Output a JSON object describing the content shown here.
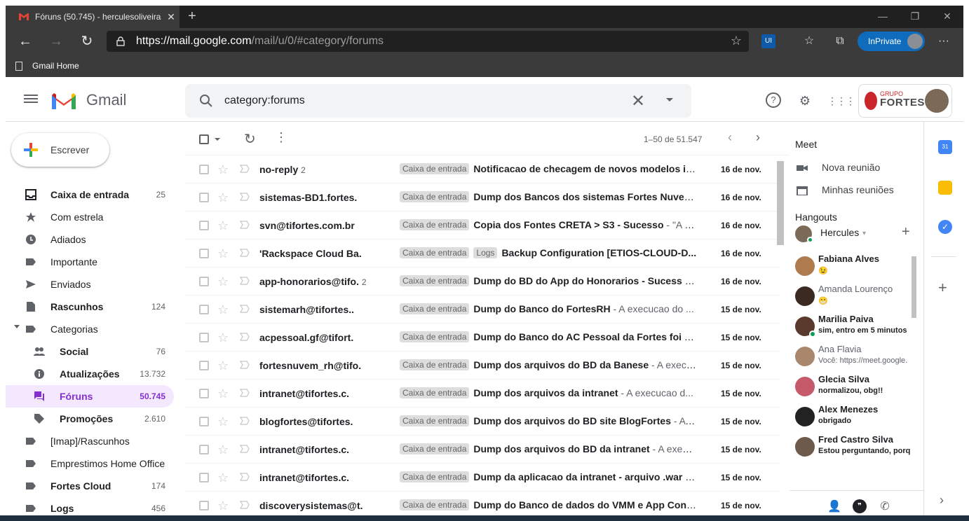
{
  "browser": {
    "tab_title": "Fóruns (50.745) - herculesoliveira",
    "url_host": "https://mail.google.com",
    "url_path": "/mail/u/0/#category/forums",
    "fav_label": "Gmail Home",
    "inprivate": "InPrivate"
  },
  "gmail": {
    "app_name": "Gmail",
    "search_value": "category:forums",
    "compose": "Escrever",
    "brand_small": "GRUPO",
    "brand": "FORTES"
  },
  "nav": [
    {
      "label": "Caixa de entrada",
      "count": "25",
      "bold": true
    },
    {
      "label": "Com estrela",
      "count": ""
    },
    {
      "label": "Adiados",
      "count": ""
    },
    {
      "label": "Importante",
      "count": ""
    },
    {
      "label": "Enviados",
      "count": ""
    },
    {
      "label": "Rascunhos",
      "count": "124",
      "bold": true
    },
    {
      "label": "Categorias",
      "count": ""
    },
    {
      "label": "Social",
      "count": "76",
      "bold": true
    },
    {
      "label": "Atualizações",
      "count": "13.732",
      "bold": true
    },
    {
      "label": "Fóruns",
      "count": "50.745",
      "bold": true
    },
    {
      "label": "Promoções",
      "count": "2.610",
      "bold": true
    },
    {
      "label": "[Imap]/Rascunhos",
      "count": ""
    },
    {
      "label": "Emprestimos Home Office",
      "count": ""
    },
    {
      "label": "Fortes Cloud",
      "count": "174",
      "bold": true
    },
    {
      "label": "Logs",
      "count": "456",
      "bold": true
    }
  ],
  "pagination": "1–50 de 51.547",
  "emails": [
    {
      "sender": "no-reply",
      "count": "2",
      "labels": [
        "Caixa de entrada"
      ],
      "subject": "Notificacao de checagem de novos modelos in...",
      "snippet": "",
      "date": "16 de nov."
    },
    {
      "sender": "sistemas-BD1.fortes.",
      "count": "",
      "labels": [
        "Caixa de entrada"
      ],
      "subject": "Dump dos Bancos dos sistemas Fortes Nuvem...",
      "snippet": "",
      "date": "16 de nov."
    },
    {
      "sender": "svn@tifortes.com.br",
      "count": "",
      "labels": [
        "Caixa de entrada"
      ],
      "subject": "Copia dos Fontes CRETA > S3 - Sucesso",
      "snippet": " - \"A e...",
      "date": "16 de nov."
    },
    {
      "sender": "'Rackspace Cloud Ba.",
      "count": "",
      "labels": [
        "Caixa de entrada",
        "Logs"
      ],
      "subject": "Backup Configuration [ETIOS-CLOUD-D...",
      "snippet": "",
      "date": "16 de nov."
    },
    {
      "sender": "app-honorarios@tifo.",
      "count": "2",
      "labels": [
        "Caixa de entrada"
      ],
      "subject": "Dump do BD do App do Honorarios - Sucess",
      "snippet": " - A...",
      "date": "16 de nov."
    },
    {
      "sender": "sistemarh@tifortes..",
      "count": "",
      "labels": [
        "Caixa de entrada"
      ],
      "subject": "Dump do Banco do FortesRH",
      "snippet": " - A execucao do ...",
      "date": "15 de nov."
    },
    {
      "sender": "acpessoal.gf@tifort.",
      "count": "",
      "labels": [
        "Caixa de entrada"
      ],
      "subject": "Dump do Banco do AC Pessoal da Fortes foi c...",
      "snippet": "",
      "date": "15 de nov."
    },
    {
      "sender": "fortesnuvem_rh@tifo.",
      "count": "",
      "labels": [
        "Caixa de entrada"
      ],
      "subject": "Dump dos arquivos do BD da Banese",
      "snippet": " - A execu...",
      "date": "15 de nov."
    },
    {
      "sender": "intranet@tifortes.c.",
      "count": "",
      "labels": [
        "Caixa de entrada"
      ],
      "subject": "Dump dos arquivos da intranet",
      "snippet": " - A execucao d...",
      "date": "15 de nov."
    },
    {
      "sender": "blogfortes@tifortes.",
      "count": "",
      "labels": [
        "Caixa de entrada"
      ],
      "subject": "Dump dos arquivos do BD site BlogFortes",
      "snippet": " - A e...",
      "date": "15 de nov."
    },
    {
      "sender": "intranet@tifortes.c.",
      "count": "",
      "labels": [
        "Caixa de entrada"
      ],
      "subject": "Dump dos arquivos do BD da intranet",
      "snippet": " - A execu...",
      "date": "15 de nov."
    },
    {
      "sender": "intranet@tifortes.c.",
      "count": "",
      "labels": [
        "Caixa de entrada"
      ],
      "subject": "Dump da aplicacao da intranet - arquivo .war",
      "snippet": " - A...",
      "date": "15 de nov."
    },
    {
      "sender": "discoverysistemas@t.",
      "count": "",
      "labels": [
        "Caixa de entrada"
      ],
      "subject": "Dump do Banco de dados do VMM e App Contr...",
      "snippet": "",
      "date": "15 de nov."
    }
  ],
  "meet": {
    "title": "Meet",
    "new": "Nova reunião",
    "mine": "Minhas reuniões"
  },
  "hangouts": {
    "title": "Hangouts",
    "me": "Hercules",
    "contacts": [
      {
        "name": "Fabiana Alves",
        "msg": "😉",
        "style": "b",
        "color": "#b07a4f",
        "online": false
      },
      {
        "name": "Amanda Lourenço",
        "msg": "😁",
        "style": "g",
        "color": "#3a2a22",
        "online": false
      },
      {
        "name": "Marilia Paiva",
        "msg": "sim, entro em 5 minutos",
        "style": "b",
        "color": "#5b3a2e",
        "online": true
      },
      {
        "name": "Ana Flavia",
        "msg": "Você: https://meet.google.",
        "style": "g",
        "color": "#a8876d",
        "online": false
      },
      {
        "name": "Glecia Silva",
        "msg": "normalizou, obg!!",
        "style": "b",
        "color": "#c45a6a",
        "online": false
      },
      {
        "name": "Alex Menezes",
        "msg": "obrigado",
        "style": "b",
        "color": "#222",
        "online": false
      },
      {
        "name": "Fred Castro Silva",
        "msg": "Estou perguntando, porq",
        "style": "b",
        "color": "#6d5a4a",
        "online": false
      }
    ]
  }
}
